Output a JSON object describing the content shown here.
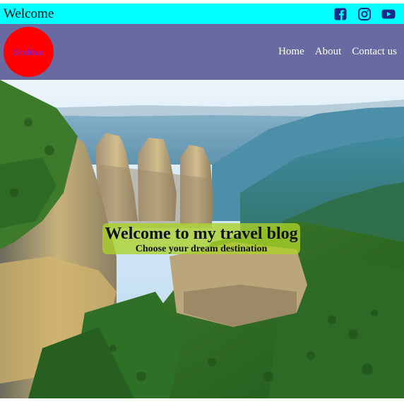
{
  "topbar": {
    "welcome": "Welcome",
    "socials": [
      {
        "icon": "facebook-icon",
        "color": "#1e2a8a"
      },
      {
        "icon": "instagram-icon",
        "color": "#1e2a8a"
      },
      {
        "icon": "youtube-icon",
        "color": "#1e2a8a"
      }
    ]
  },
  "nav": {
    "logo_text": "Shekhar",
    "items": [
      "Home",
      "About",
      "Contact us"
    ]
  },
  "hero": {
    "title": "Welcome to my travel blog",
    "subtitle": "Choose your dream destination"
  },
  "colors": {
    "topbar_bg": "#00ffff",
    "navbar_bg": "#6a6aa3",
    "logo_bg": "#ff0000",
    "banner_bg": "#aad228"
  }
}
